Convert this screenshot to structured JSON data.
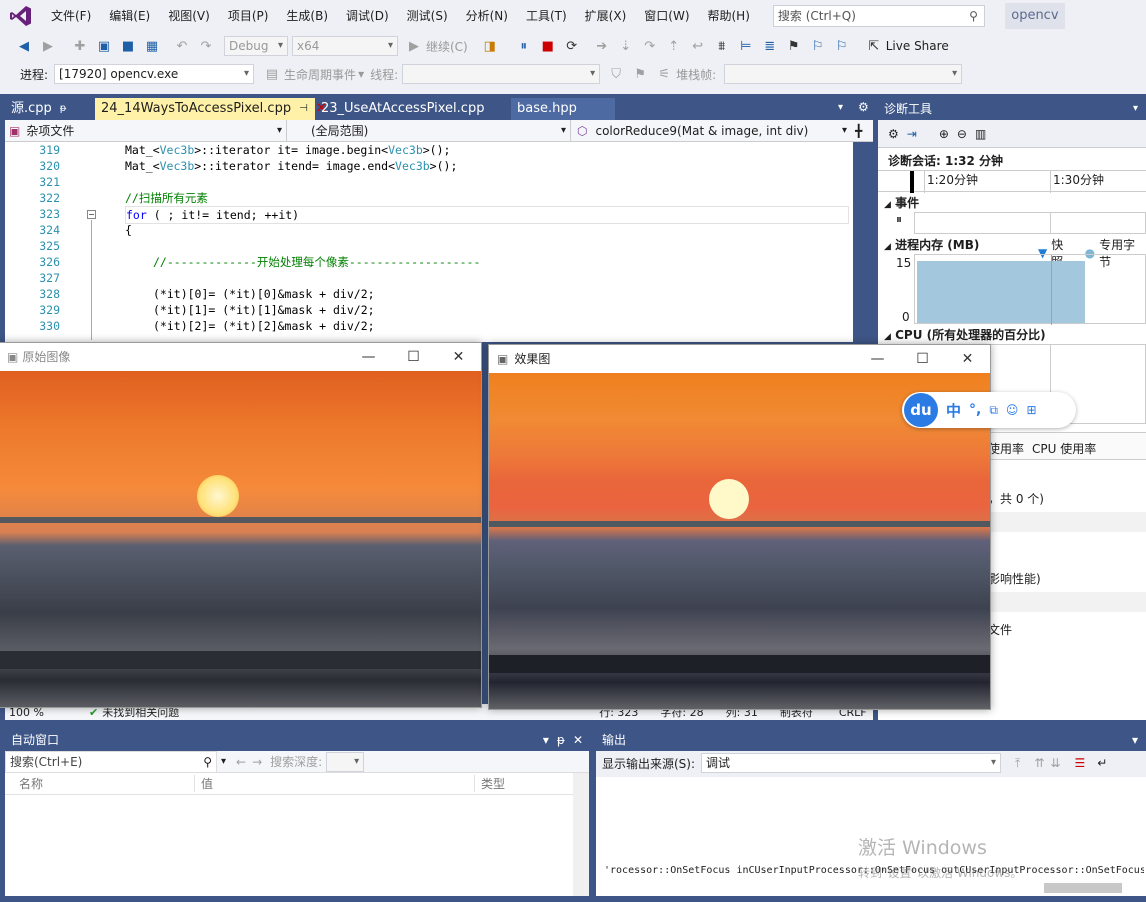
{
  "menu": [
    "文件(F)",
    "编辑(E)",
    "视图(V)",
    "项目(P)",
    "生成(B)",
    "调试(D)",
    "测试(S)",
    "分析(N)",
    "工具(T)",
    "扩展(X)",
    "窗口(W)",
    "帮助(H)"
  ],
  "search": {
    "placeholder": "搜索 (Ctrl+Q)"
  },
  "solution_name": "opencv",
  "toolbar": {
    "config": "Debug",
    "platform": "x64",
    "continue": "继续(C)",
    "live_share": "Live Share"
  },
  "process_bar": {
    "process_label": "进程:",
    "process_value": "[17920] opencv.exe",
    "lifecycle": "生命周期事件",
    "thread_label": "线程:",
    "stack_label": "堆栈帧:"
  },
  "tabs": [
    {
      "label": "源.cpp",
      "pin": "ᵽ"
    },
    {
      "label": "24_14WaysToAccessPixel.cpp",
      "pin": "⊣",
      "close": "✕"
    },
    {
      "label": "23_UseAtAccessPixel.cpp"
    },
    {
      "label": "base.hpp"
    }
  ],
  "nav": {
    "file": "杂项文件",
    "scope": "(全局范围)",
    "member": "colorReduce9(Mat & image, int div)"
  },
  "code": {
    "lines": [
      "319",
      "320",
      "321",
      "322",
      "323",
      "324",
      "325",
      "326",
      "327",
      "328",
      "329",
      "330"
    ],
    "l319a": "Mat_<",
    "l319t": "Vec3b",
    "l319b": ">::iterator it= image.begin<",
    "l319c": ">();",
    "l320a": "Mat_<",
    "l320t": "Vec3b",
    "l320b": ">::iterator itend= image.end<",
    "l320c": ">();",
    "l322": "//扫描所有元素",
    "l323kw": "for",
    "l323": " ( ; it!= itend; ++it)",
    "l324": "{",
    "l326": "//-------------开始处理每个像素-------------------",
    "l328": "(*it)[0]= (*it)[0]&mask + div/2;",
    "l329": "(*it)[1]= (*it)[1]&mask + div/2;",
    "l330": "(*it)[2]= (*it)[2]&mask + div/2;"
  },
  "win_original": {
    "title": "原始图像"
  },
  "win_effect": {
    "title": "效果图"
  },
  "diag": {
    "title": "诊断工具",
    "session": "诊断会话: 1:32 分钟",
    "t1": "1:20分钟",
    "t2": "1:30分钟",
    "events": "事件",
    "memory": "进程内存 (MB)",
    "snapshot": "快照",
    "private": "专用字节",
    "ymax": "15",
    "ymin": "0",
    "cpu": "CPU (所有处理器的百分比)",
    "usage_a": "使用率",
    "usage_b": "CPU 使用率",
    "count": "，共 0 个)",
    "perf": "影响性能)",
    "file": "文件"
  },
  "ime": {
    "logo": "du",
    "chars": [
      "中",
      "°,"
    ]
  },
  "status": {
    "zoom": "100 %",
    "issues": "未找到相关问题",
    "line": "行: 323",
    "char": "字符: 28",
    "col": "列: 31",
    "tabs": "制表符",
    "crlf": "CRLF"
  },
  "auto_window": {
    "title": "自动窗口",
    "search": "搜索(Ctrl+E)",
    "depth": "搜索深度:",
    "col_name": "名称",
    "col_value": "值",
    "col_type": "类型"
  },
  "output": {
    "title": "输出",
    "source_label": "显示输出来源(S):",
    "source": "调试",
    "text": "'rocessor::OnSetFocus inCUserInputProcessor::OnSetFocus outCUserInputProcessor::OnSetFocus"
  },
  "watermark": {
    "line1": "激活 Windows",
    "line2": "转到\"设置\"以激活 Windows。"
  }
}
